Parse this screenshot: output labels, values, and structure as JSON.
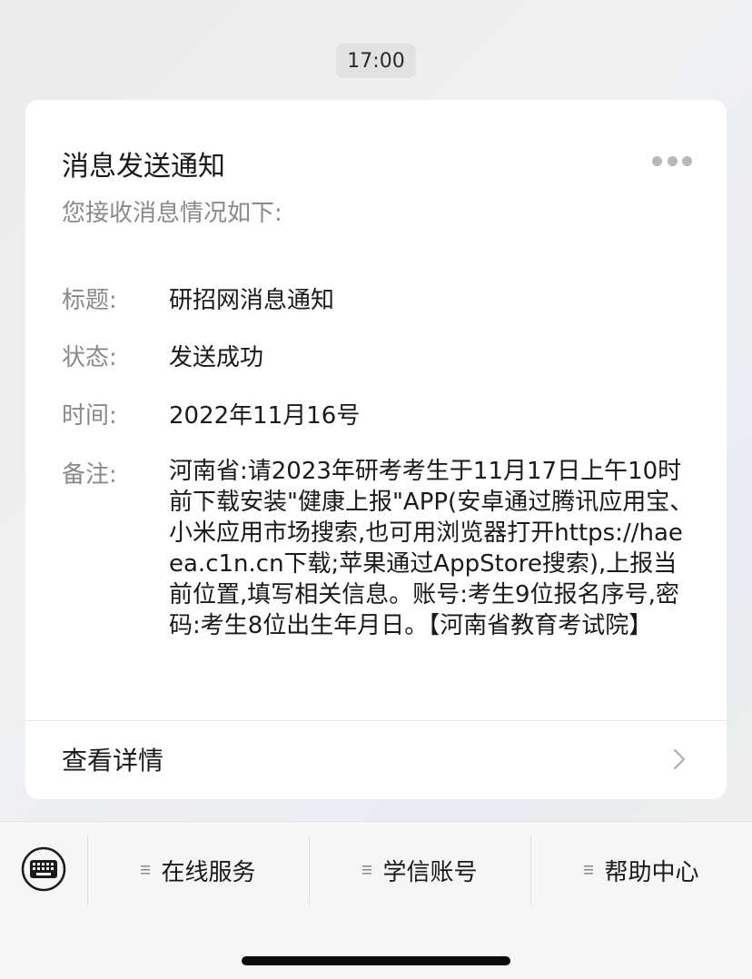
{
  "timestamp": "17:00",
  "card": {
    "title": "消息发送通知",
    "subtitle": "您接收消息情况如下:",
    "rows": [
      {
        "label": "标题:",
        "value": "研招网消息通知"
      },
      {
        "label": "状态:",
        "value": "发送成功"
      },
      {
        "label": "时间:",
        "value": "2022年11月16号"
      },
      {
        "label": "备注:",
        "value": "河南省:请2023年研考考生于11月17日上午10时前下载安装\"健康上报\"APP(安卓通过腾讯应用宝、小米应用市场搜索,也可用浏览器打开https://haeea.c1n.cn下载;苹果通过AppStore搜索),上报当前位置,填写相关信息。账号:考生9位报名序号,密码:考生8位出生年月日。【河南省教育考试院】"
      }
    ],
    "details_label": "查看详情",
    "more_icon": "more-dots-icon",
    "chevron_icon": "chevron-right-icon"
  },
  "bottom_menu": {
    "keyboard_icon": "keyboard-icon",
    "items": [
      {
        "label": "在线服务",
        "icon": "menu-lines-icon"
      },
      {
        "label": "学信账号",
        "icon": "menu-lines-icon"
      },
      {
        "label": "帮助中心",
        "icon": "menu-lines-icon"
      }
    ]
  },
  "colors": {
    "card_bg": "#ffffff",
    "label_gray": "#8a8a8a",
    "text_dark": "#1a1a1a",
    "bar_bg": "#f6f6f6"
  }
}
